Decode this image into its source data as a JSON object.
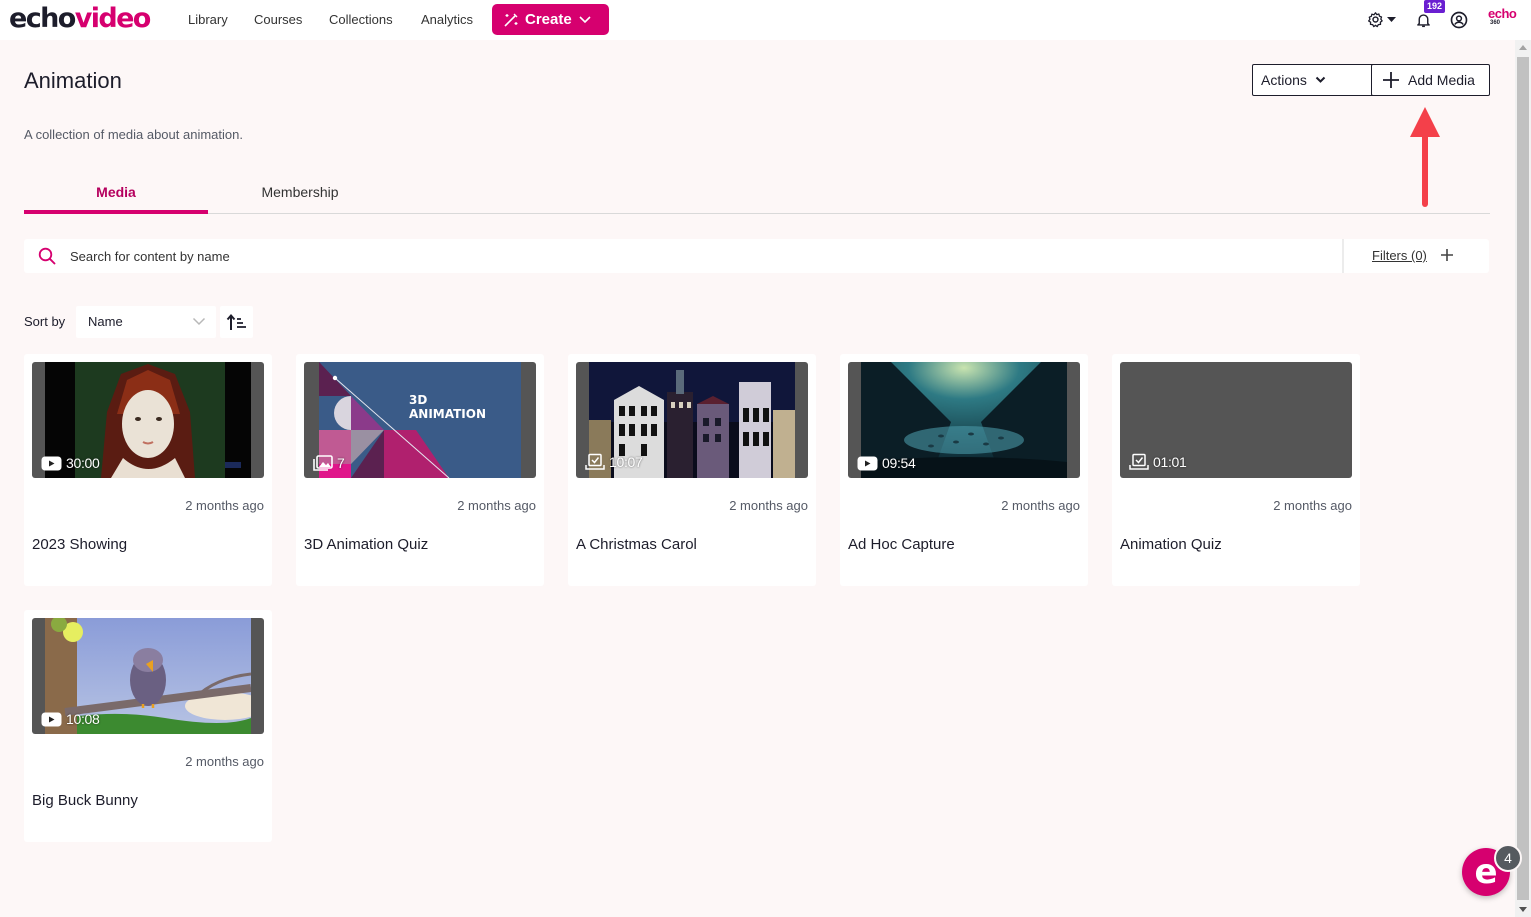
{
  "brand": {
    "logo_echo": "echo",
    "logo_video": "video",
    "accent_color": "#d6006f",
    "corner_logo_top": "echo",
    "corner_logo_bottom": "360"
  },
  "nav": {
    "links": [
      "Library",
      "Courses",
      "Collections",
      "Analytics"
    ],
    "create_label": "Create",
    "notification_count": "192"
  },
  "header": {
    "title": "Animation",
    "description": "A collection of media about animation.",
    "actions_label": "Actions",
    "add_media_label": "Add Media"
  },
  "tabs": [
    {
      "label": "Media",
      "active": true
    },
    {
      "label": "Membership",
      "active": false
    }
  ],
  "search": {
    "placeholder": "Search for content by name",
    "value": "",
    "filters_label": "Filters (0)"
  },
  "sort": {
    "label": "Sort by",
    "selected": "Name",
    "order": "ascending"
  },
  "media": [
    {
      "title": "2023 Showing",
      "date": "2 months ago",
      "type_icon": "video-icon",
      "duration": "30:00"
    },
    {
      "title": "3D Animation Quiz",
      "date": "2 months ago",
      "type_icon": "image-gallery-icon",
      "duration": "7",
      "thumb_text_1": "3D",
      "thumb_text_2": "ANIMATION"
    },
    {
      "title": "A Christmas Carol",
      "date": "2 months ago",
      "type_icon": "quiz-icon",
      "duration": "10:07"
    },
    {
      "title": "Ad Hoc Capture",
      "date": "2 months ago",
      "type_icon": "video-icon",
      "duration": "09:54"
    },
    {
      "title": "Animation Quiz",
      "date": "2 months ago",
      "type_icon": "quiz-icon",
      "duration": "01:01"
    },
    {
      "title": "Big Buck Bunny",
      "date": "2 months ago",
      "type_icon": "video-icon",
      "duration": "10:08"
    }
  ],
  "chat": {
    "badge_count": "4",
    "glyph": "e"
  }
}
